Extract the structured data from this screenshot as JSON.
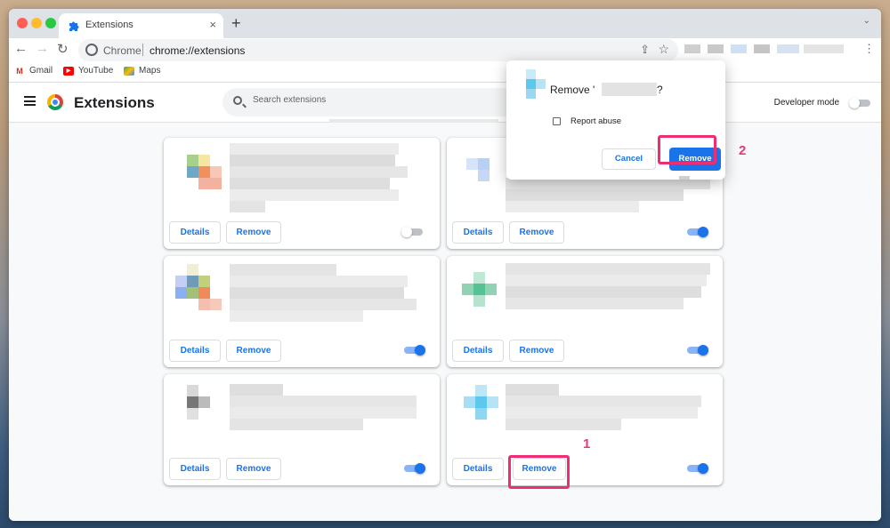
{
  "tab": {
    "title": "Extensions",
    "icon": "puzzle-icon"
  },
  "toolbar": {
    "origin_label": "Chrome",
    "url": "chrome://extensions"
  },
  "bookmarks": [
    {
      "label": "Gmail",
      "icon": "gmail-icon"
    },
    {
      "label": "YouTube",
      "icon": "youtube-icon"
    },
    {
      "label": "Maps",
      "icon": "maps-icon"
    }
  ],
  "header": {
    "title": "Extensions",
    "search_placeholder": "Search extensions",
    "developer_mode_label": "Developer mode",
    "developer_mode_on": false
  },
  "cards": [
    {
      "details_label": "Details",
      "remove_label": "Remove",
      "enabled": false
    },
    {
      "details_label": "Details",
      "remove_label": "Remove",
      "enabled": true
    },
    {
      "details_label": "Details",
      "remove_label": "Remove",
      "enabled": true
    },
    {
      "details_label": "Details",
      "remove_label": "Remove",
      "enabled": true
    },
    {
      "details_label": "Details",
      "remove_label": "Remove",
      "enabled": true
    },
    {
      "details_label": "Details",
      "remove_label": "Remove",
      "enabled": true
    }
  ],
  "dialog": {
    "title_prefix": "Remove '",
    "title_suffix": "?",
    "report_abuse_label": "Report abuse",
    "cancel_label": "Cancel",
    "remove_label": "Remove"
  },
  "annotations": {
    "step1": "1",
    "step2": "2"
  },
  "colors": {
    "accent": "#1a73e8",
    "highlight": "#ee2d74"
  }
}
